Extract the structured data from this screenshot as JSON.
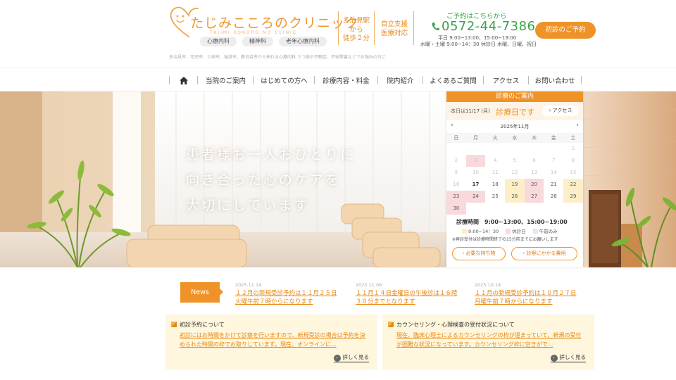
{
  "header": {
    "clinic_name": "たじみこころのクリニック",
    "clinic_name_romaji": "TAJIMI KOKORO NO CLINIC",
    "departments": [
      "心療内科",
      "精神科",
      "老年心療内科"
    ],
    "description": "多治見市、可児市、土岐市、瑞浪市、春日井市から来れる心療内科 うつ病や不眠症、不安障害などでお悩みの方に",
    "access_lines": [
      "多治見駅",
      "から",
      "徒歩２分"
    ],
    "support_lines": [
      "自立支援",
      "医療対応"
    ],
    "reserve_label": "ご予約はこちらから",
    "phone": "0572-44-7386",
    "hours_line1": "平日 9:00~13:00、15:00~19:00",
    "hours_line2": "水曜・土曜 9:00~14：30 休診日 木曜、日曜、祝日",
    "first_visit_button": "初診のご予約"
  },
  "nav": {
    "home_icon": "home-icon",
    "items": [
      "当院のご案内",
      "はじめての方へ",
      "診療内容・料金",
      "院内紹介",
      "よくあるご質問",
      "アクセス",
      "お問い合わせ"
    ]
  },
  "hero": {
    "lines": [
      "患者様お一人おひとりに",
      "向き合った心のケアを",
      "大切にしています"
    ]
  },
  "calendar": {
    "header": "診療のご案内",
    "today_label": "本日は",
    "today_date": "11/17 (月)",
    "today_status": "診療日です",
    "access_button": "アクセス",
    "month_label": "2025年11月",
    "prev": "‹",
    "next": "›",
    "weekdays": [
      "日",
      "月",
      "火",
      "水",
      "木",
      "金",
      "土"
    ],
    "weeks": [
      [
        {
          "d": ""
        },
        {
          "d": ""
        },
        {
          "d": ""
        },
        {
          "d": ""
        },
        {
          "d": ""
        },
        {
          "d": ""
        },
        {
          "d": "1",
          "s": "past"
        }
      ],
      [
        {
          "d": "2",
          "s": "past"
        },
        {
          "d": "3",
          "s": "past pink"
        },
        {
          "d": "4",
          "s": "past"
        },
        {
          "d": "5",
          "s": "past"
        },
        {
          "d": "6",
          "s": "past"
        },
        {
          "d": "7",
          "s": "past"
        },
        {
          "d": "8",
          "s": "past"
        }
      ],
      [
        {
          "d": "9",
          "s": "past"
        },
        {
          "d": "10",
          "s": "past"
        },
        {
          "d": "11",
          "s": "past"
        },
        {
          "d": "12",
          "s": "past"
        },
        {
          "d": "13",
          "s": "past"
        },
        {
          "d": "14",
          "s": "past"
        },
        {
          "d": "15",
          "s": "past"
        }
      ],
      [
        {
          "d": "16",
          "s": "past"
        },
        {
          "d": "17",
          "s": "bold"
        },
        {
          "d": "18"
        },
        {
          "d": "19",
          "s": "yellow"
        },
        {
          "d": "20",
          "s": "pink"
        },
        {
          "d": "21"
        },
        {
          "d": "22",
          "s": "yellow"
        }
      ],
      [
        {
          "d": "23",
          "s": "pink"
        },
        {
          "d": "24",
          "s": "pink"
        },
        {
          "d": "25"
        },
        {
          "d": "26",
          "s": "yellow"
        },
        {
          "d": "27",
          "s": "pink"
        },
        {
          "d": "28"
        },
        {
          "d": "29",
          "s": "yellow"
        }
      ],
      [
        {
          "d": "30",
          "s": "pink"
        },
        {
          "d": ""
        },
        {
          "d": ""
        },
        {
          "d": ""
        },
        {
          "d": ""
        },
        {
          "d": ""
        },
        {
          "d": ""
        }
      ]
    ],
    "hours_title": "診療時間　9:00~13:00、15:00~19:00",
    "legend": [
      {
        "label": "9:00~14：30",
        "color": "#fcefc8"
      },
      {
        "label": "休診日",
        "color": "#f9d9dc"
      },
      {
        "label": "午前のみ",
        "color": "#dbe9f8"
      }
    ],
    "note": "※再診受付は診療時間終了の15分前までにお願いします",
    "button_items": "必要な持ち物",
    "button_fees": "診察にかかる費用"
  },
  "news": {
    "label": "News",
    "items": [
      {
        "date": "2025.11.14",
        "title": "１２月の新規受診予約は１１月２５日火曜午前７時からになります"
      },
      {
        "date": "2025.11.06",
        "title": "１１月１４日金曜日の午後診は１６時３０分までとなります"
      },
      {
        "date": "2025.10.18",
        "title": "１１月の新規受診予約は１０月２７日月曜午前７時からになります"
      }
    ]
  },
  "cards": [
    {
      "title": "初診予約について",
      "body": "初診にはお時間をかけて診察を行いますので、新規受診の場合は予約を決められた時間の枠でお取りしています。現在、オンラインに...",
      "more": "詳しく見る"
    },
    {
      "title": "カウンセリング・心理検査の受付状況について",
      "body": "現在、臨床心理士によるカウンセリングの枠が埋まっていて、新規の受付が困難な状況になっています。カウンセリング枠に空きがで...",
      "more": "詳しく見る"
    }
  ],
  "colors": {
    "accent": "#ef9328",
    "green": "#3aa14a",
    "pink": "#f9d9dc",
    "yellow": "#fcefc8",
    "blue": "#dbe9f8"
  }
}
